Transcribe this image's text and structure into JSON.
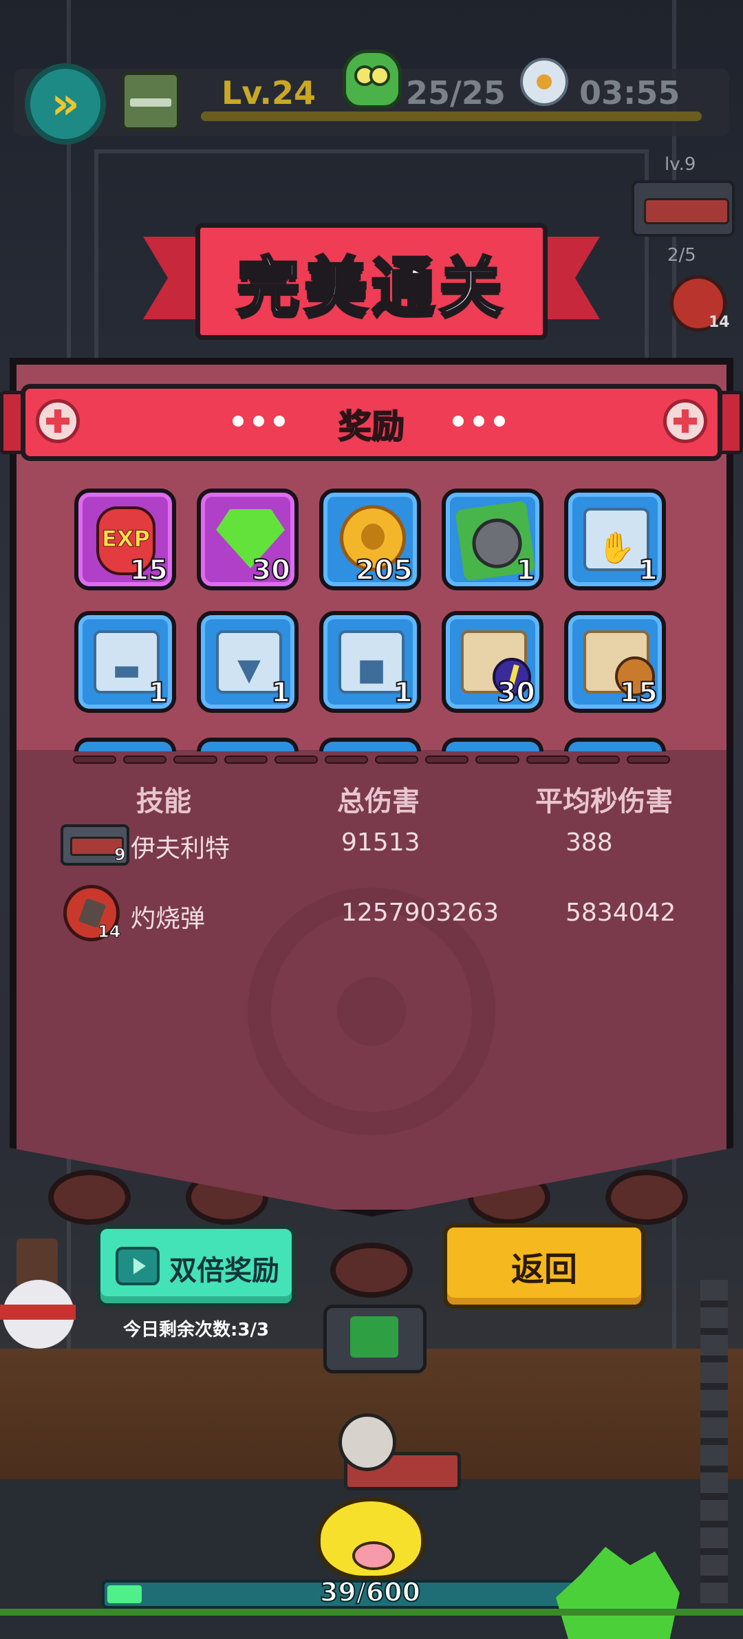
{
  "hud": {
    "level": "Lv.24",
    "enemy_count": "25/25",
    "timer": "03:55",
    "icons": [
      "fast-forward-icon",
      "chest-icon",
      "zombie-icon",
      "clock-icon"
    ]
  },
  "side_slot": {
    "weapon_level": "lv.9",
    "slot_fraction": "2/5",
    "skill_count": "14"
  },
  "banner": {
    "title": "完美通关"
  },
  "rewards_panel": {
    "header": "奖励",
    "items": [
      {
        "icon": "exp-potion-icon",
        "qty": "15",
        "style": "purple"
      },
      {
        "icon": "green-gem-icon",
        "qty": "30",
        "style": "purple"
      },
      {
        "icon": "skull-coin-icon",
        "qty": "205",
        "style": "blue"
      },
      {
        "icon": "character-card-icon",
        "qty": "1",
        "style": "blue"
      },
      {
        "icon": "glove-blueprint-icon",
        "qty": "1",
        "style": "blue"
      },
      {
        "icon": "pistol-blueprint-icon",
        "qty": "1",
        "style": "blue"
      },
      {
        "icon": "armor-blueprint-icon",
        "qty": "1",
        "style": "blue"
      },
      {
        "icon": "shirt-blueprint-icon",
        "qty": "1",
        "style": "blue"
      },
      {
        "icon": "lightning-scroll-icon",
        "qty": "30",
        "style": "blue"
      },
      {
        "icon": "bug-scroll-icon",
        "qty": "15",
        "style": "blue"
      }
    ]
  },
  "stats": {
    "headers": {
      "skill": "技能",
      "total_damage": "总伤害",
      "dps": "平均秒伤害"
    },
    "rows": [
      {
        "icon": "rocket-launcher-icon",
        "badge": "9",
        "name": "伊夫利特",
        "total": "91513",
        "dps": "388"
      },
      {
        "icon": "fire-bullet-icon",
        "badge": "14",
        "name": "灼烧弹",
        "total": "1257903263",
        "dps": "5834042"
      }
    ]
  },
  "buttons": {
    "double_reward": "双倍奖励",
    "remaining": "今日剩余次数:3/3",
    "back": "返回"
  },
  "progress": {
    "text": "39/600",
    "fraction": 0.065
  },
  "colors": {
    "banner_red": "#ee3d55",
    "panel": "#7a3a4b",
    "double_button": "#43e3b7",
    "back_button": "#f5b81f"
  }
}
